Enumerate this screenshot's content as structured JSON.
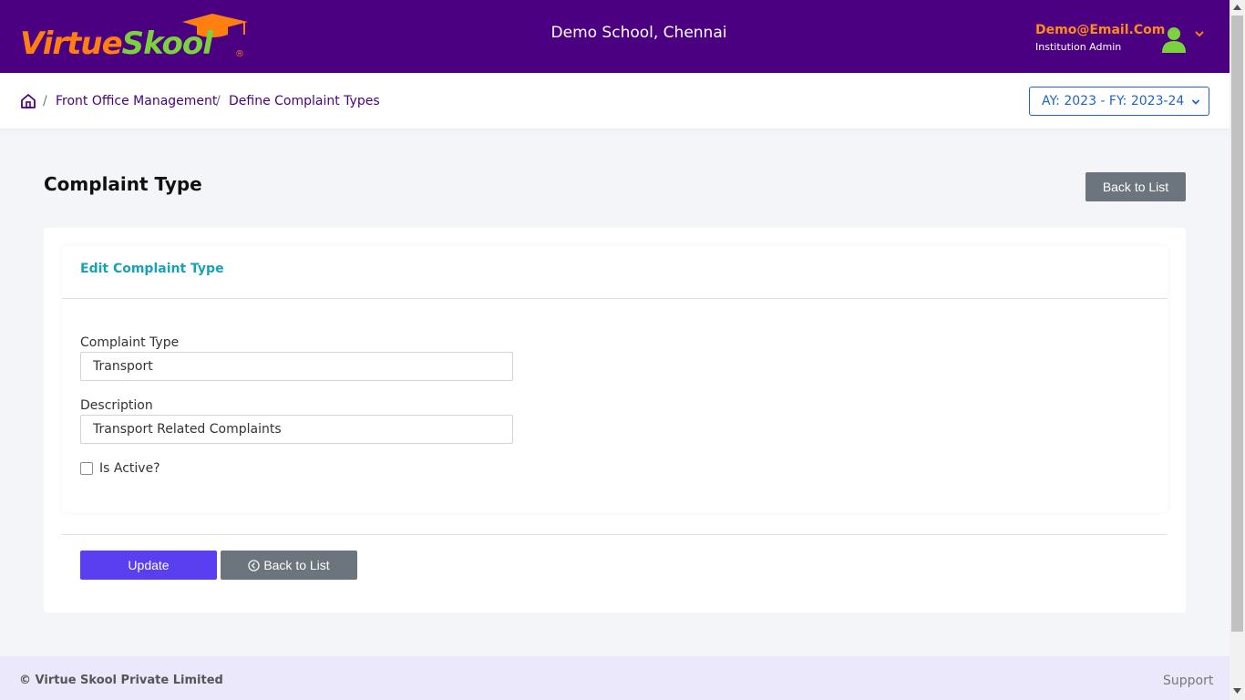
{
  "header": {
    "logo_part1": "Virtue",
    "logo_part2": "Skool",
    "logo_reg": "®",
    "school_name": "Demo School, Chennai",
    "user_email": "Demo@Email.Com",
    "user_role": "Institution Admin"
  },
  "breadcrumb": {
    "items": [
      "Front Office Management",
      "Define Complaint Types"
    ],
    "separator": "/"
  },
  "year_selector": {
    "value": "AY: 2023 - FY: 2023-24"
  },
  "page": {
    "title": "Complaint Type",
    "back_button": "Back to List"
  },
  "form": {
    "section_title": "Edit Complaint Type",
    "complaint_type_label": "Complaint Type",
    "complaint_type_value": "Transport",
    "description_label": "Description",
    "description_value": "Transport Related Complaints",
    "is_active_label": "Is Active?",
    "is_active_checked": false,
    "update_button": "Update",
    "back_button": "Back to List"
  },
  "footer": {
    "copyright": "© Virtue Skool Private Limited",
    "support": "Support"
  },
  "colors": {
    "header_bg": "#4b0082",
    "accent_orange": "#ff7f11",
    "logo_green": "#7bd23c",
    "primary_button": "#5a3ff0",
    "secondary_button": "#6c757d",
    "section_title": "#17a2b8",
    "footer_bg": "#ece8fc"
  },
  "icons": {
    "logo": "graduation-cap-icon",
    "avatar": "user-icon",
    "user_menu": "chevron-down-icon",
    "home": "home-icon",
    "back": "arrow-left-circle-icon"
  }
}
